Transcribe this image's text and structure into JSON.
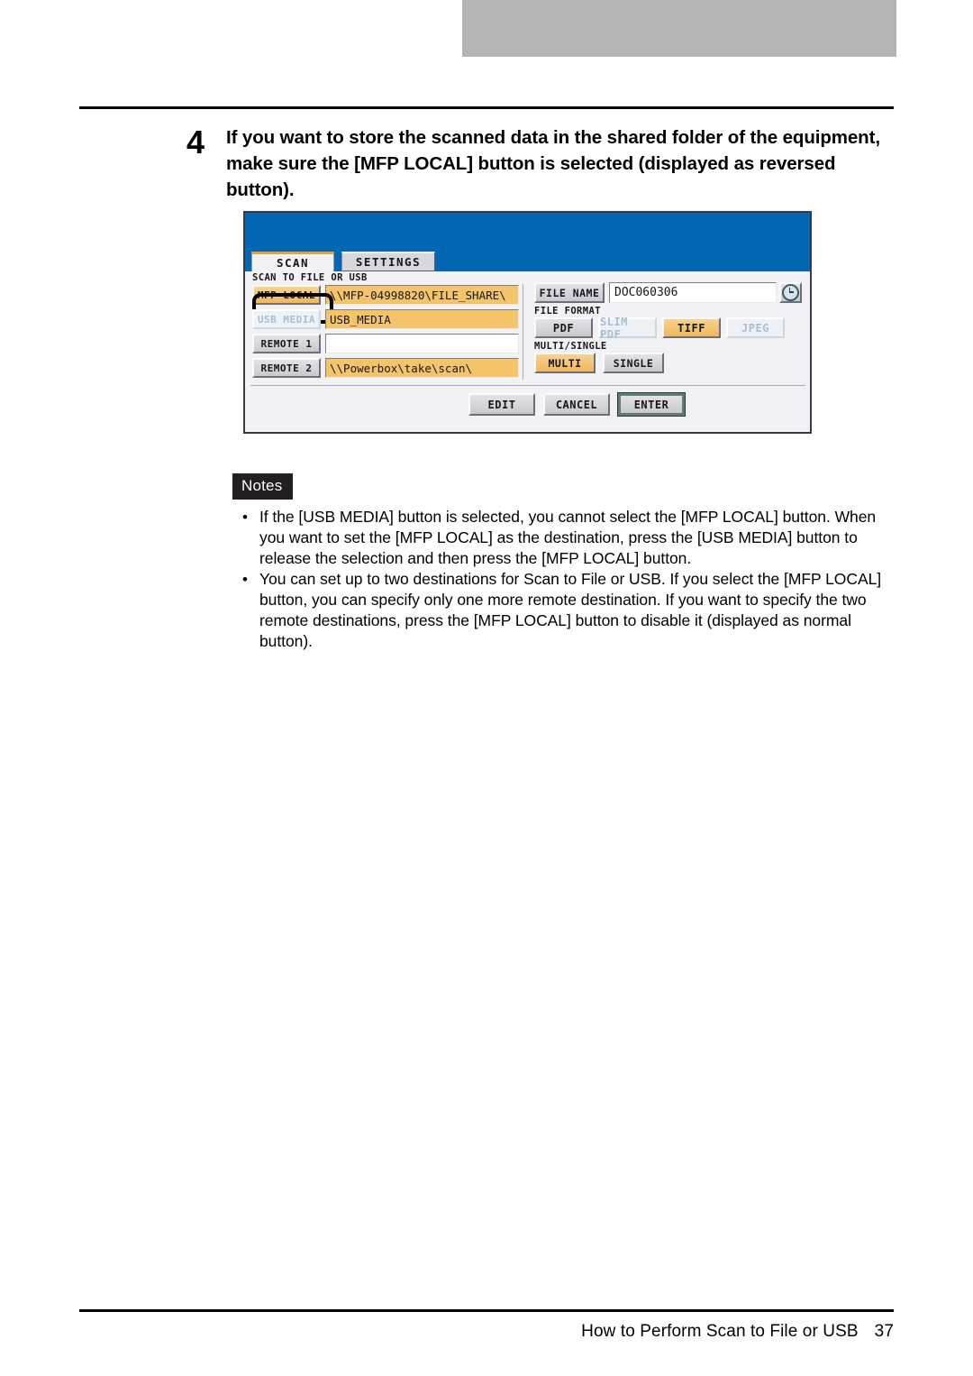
{
  "step": {
    "number": "4",
    "text": "If you want to store the scanned data in the shared folder of the equipment, make sure the [MFP LOCAL] button is selected (displayed as reversed button)."
  },
  "device_screen": {
    "tabs": [
      {
        "label": "SCAN",
        "state": "active"
      },
      {
        "label": "SETTINGS",
        "state": "inactive"
      }
    ],
    "section_captions": {
      "scan_to": "SCAN TO FILE OR USB",
      "file_format": "FILE FORMAT",
      "multi_single": "MULTI/SINGLE"
    },
    "destinations": [
      {
        "button": "MFP LOCAL",
        "button_state": "selected-highlighted",
        "path": "\\\\MFP-04998820\\FILE_SHARE\\",
        "path_state": "filled"
      },
      {
        "button": "USB MEDIA",
        "button_state": "disabled",
        "path": "USB_MEDIA",
        "path_state": "filled"
      },
      {
        "button": "REMOTE 1",
        "button_state": "normal",
        "path": "",
        "path_state": "empty"
      },
      {
        "button": "REMOTE 2",
        "button_state": "normal",
        "path": "\\\\Powerbox\\take\\scan\\",
        "path_state": "filled"
      }
    ],
    "file_name": {
      "button": "FILE NAME",
      "value": "DOC060306",
      "clock_icon": "clock-icon"
    },
    "file_format_buttons": [
      {
        "label": "PDF",
        "state": "normal"
      },
      {
        "label": "SLIM PDF",
        "state": "disabled"
      },
      {
        "label": "TIFF",
        "state": "selected"
      },
      {
        "label": "JPEG",
        "state": "disabled"
      }
    ],
    "multi_single_buttons": [
      {
        "label": "MULTI",
        "state": "selected"
      },
      {
        "label": "SINGLE",
        "state": "normal"
      }
    ],
    "action_buttons": [
      {
        "label": "EDIT",
        "state": "normal"
      },
      {
        "label": "CANCEL",
        "state": "normal"
      },
      {
        "label": "ENTER",
        "state": "emphasized"
      }
    ],
    "colors": {
      "header_blue": "#0467b3",
      "selected_amber": "#f4c46a",
      "tab_accent": "#e8a33d",
      "panel_gray": "#f2f2f4"
    }
  },
  "notes": {
    "badge": "Notes",
    "bullet": "•",
    "items": [
      "If the [USB MEDIA] button is selected, you cannot select the [MFP LOCAL] button. When you want to set the [MFP LOCAL] as the destination, press the [USB MEDIA] button to release the selection and then press the [MFP LOCAL] button.",
      "You can set up to two destinations for Scan to File or USB.  If you select the [MFP LOCAL] button, you can specify only one more remote destination.  If you want to specify the two remote destinations, press the [MFP LOCAL] button to disable it (displayed as normal button)."
    ]
  },
  "footer": {
    "title": "How to Perform Scan to File or USB",
    "page_number": "37"
  }
}
